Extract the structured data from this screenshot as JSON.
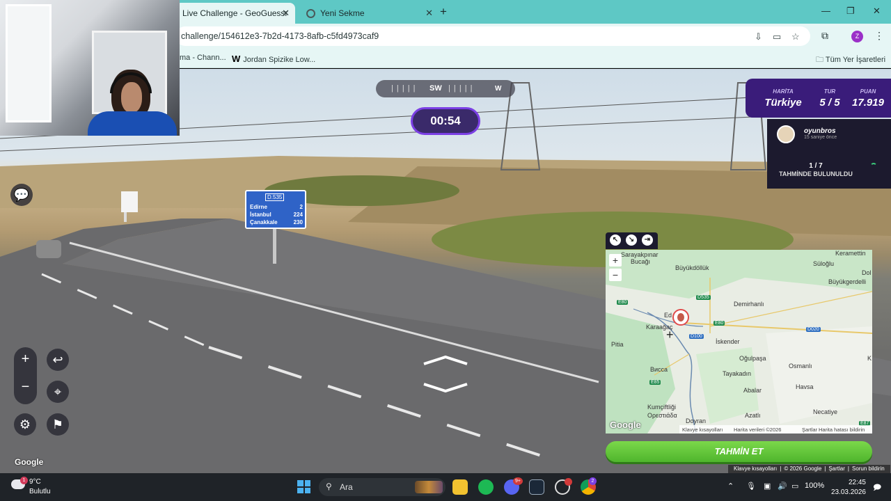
{
  "browser": {
    "active_tab_title": "Live Challenge - GeoGuessr",
    "inactive_tab_title": "Yeni Sekme",
    "url": "challenge/154612e3-7b2d-4173-8afb-c5fd4973caf9",
    "profile_initial": "Z",
    "bookmarks": [
      "ma - Chann...",
      "Jordan Spizike Low..."
    ],
    "bookmark_w": "W",
    "all_bookmarks": "Tüm Yer İşaretleri"
  },
  "game": {
    "compass": {
      "primary": "SW",
      "secondary": "W",
      "ticks": "| | | |  |"
    },
    "timer": "00:54",
    "map_label": "HARİTA",
    "map_value": "Türkiye",
    "round_label": "TUR",
    "round_value": "5 / 5",
    "score_label": "PUAN",
    "score_value": "17.919",
    "player_name": "oyunbros",
    "player_time": "15 saniye önce",
    "found_count": "1 / 7",
    "found_label": "TAHMİNDE BULUNULDU",
    "guess_button": "TAHMİN ET"
  },
  "road_sign": {
    "route": "D.535",
    "rows": [
      {
        "city": "Edirne",
        "km": "2"
      },
      {
        "city": "İstanbul",
        "km": "224"
      },
      {
        "city": "Çanakkale",
        "km": "230"
      }
    ]
  },
  "map": {
    "labels": [
      "Sarayakpınar",
      "Bucağı",
      "Büyükdöllük",
      "Keramettin",
      "Süloğlu",
      "Dol",
      "Büyükgerdelli",
      "Demirhanlı",
      "Ed",
      "Karaağaç",
      "Pitia",
      "İskender",
      "Oğulpaşa",
      "Osmanlı",
      "K",
      "Tayakadın",
      "Abalar",
      "Havsa",
      "Bиссa",
      "Kumçiftliği",
      "Ορεστιάδα",
      "Azatlı",
      "Necatiye",
      "Doyran"
    ],
    "shields": [
      "E80",
      "D535",
      "E80",
      "D100",
      "D020",
      "E85",
      "E87"
    ],
    "footer": [
      "Klavye kısayolları",
      "Harita verileri ©2026",
      "Şartlar",
      "Harita hatası bildirin"
    ],
    "google": "Google"
  },
  "streetview": {
    "google": "Google",
    "footer": [
      "Klavye kısayolları",
      "© 2026 Google",
      "Şartlar",
      "Sorun bildirin"
    ]
  },
  "taskbar": {
    "weather_temp": "9°C",
    "weather_desc": "Bulutlu",
    "weather_badge": "1",
    "search_placeholder": "Ara",
    "battery": "100%",
    "time": "22:45",
    "date": "23.03.2026",
    "discord_badge": "9+",
    "chrome_badge": "2"
  },
  "colors": {
    "browser_chrome": "#5ec8c5",
    "guess_button": "#5fc534",
    "panel_purple": "#3a1c7a"
  }
}
